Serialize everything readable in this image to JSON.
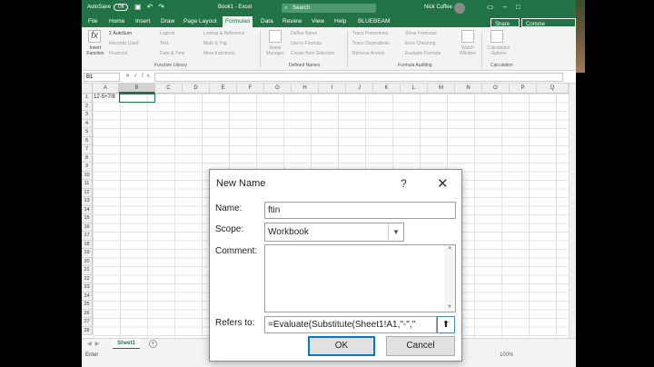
{
  "titlebar": {
    "autosave": "AutoSave",
    "toggle": "Off",
    "doc_title": "Book1 - Excel",
    "search": "Search",
    "user": "Nick Cuffee"
  },
  "menu": {
    "items": [
      "File",
      "Home",
      "Insert",
      "Draw",
      "Page Layout",
      "Formulas",
      "Data",
      "Review",
      "View",
      "Help",
      "BLUEBEAM"
    ],
    "active": "Formulas",
    "share": "Share",
    "comments": "Comme"
  },
  "ribbon": {
    "insert_function": "Insert Function",
    "fl": [
      "AutoSum",
      "Recently Used",
      "Financial",
      "Logical",
      "Text",
      "Date & Time",
      "Lookup & Reference",
      "Math & Trig",
      "More Functions"
    ],
    "function_library": "Function Library",
    "name_manager": "Name Manager",
    "dn": [
      "Define Name",
      "Use in Formula",
      "Create from Selection"
    ],
    "defined_names": "Defined Names",
    "fa": [
      "Trace Precedents",
      "Trace Dependents",
      "Remove Arrows",
      "Show Formulas",
      "Error Checking",
      "Evaluate Formula"
    ],
    "watch": "Watch Window",
    "formula_auditing": "Formula Auditing",
    "calc_options": "Calculation Options",
    "calculation": "Calculation"
  },
  "formula_bar": {
    "name_box": "B1",
    "content": ""
  },
  "grid": {
    "columns": [
      "A",
      "B",
      "C",
      "D",
      "E",
      "F",
      "G",
      "H",
      "I",
      "J",
      "K",
      "L",
      "M",
      "N",
      "O",
      "P",
      "Q"
    ],
    "selected_column": "B",
    "rows": [
      "1",
      "2",
      "3",
      "4",
      "5",
      "6",
      "7",
      "8",
      "9",
      "10",
      "11",
      "12",
      "13",
      "14",
      "15",
      "16",
      "17",
      "18",
      "19",
      "20",
      "21",
      "22",
      "23",
      "24",
      "25",
      "26",
      "27",
      "28"
    ],
    "a1": "12-5+7/8"
  },
  "sheets": {
    "tab": "Sheet1"
  },
  "status": {
    "mode": "Enter",
    "zoom": "100%"
  },
  "dialog": {
    "title": "New Name",
    "help": "?",
    "close": "✕",
    "name_label": "Name:",
    "name_value": "ftin",
    "scope_label": "Scope:",
    "scope_value": "Workbook",
    "comment_label": "Comment:",
    "comment_value": "",
    "refers_label": "Refers to:",
    "refers_value": "=Evaluate(Substitute(Sheet1!A1,\"-\",\"",
    "ok": "OK",
    "cancel": "Cancel"
  }
}
